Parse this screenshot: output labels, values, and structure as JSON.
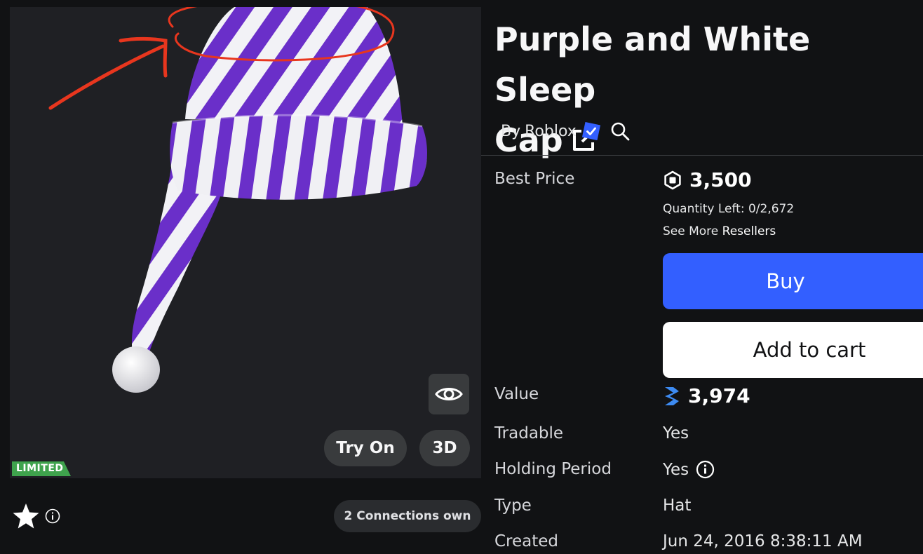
{
  "viewer": {
    "badge_limited": "LIMITED",
    "try_on_label": "Try On",
    "three_d_label": "3D",
    "eye_icon": "eye-icon"
  },
  "below_viewer": {
    "favorite_icon": "star-icon",
    "info_icon": "info-icon",
    "connections_label": "2 Connections own"
  },
  "item": {
    "title_line1": "Purple and White Sleep",
    "title_line2": "Cap",
    "creator_prefix": "By",
    "creator_name": "Roblox",
    "verified_icon": "verified-badge-icon",
    "search_icon": "search-icon"
  },
  "details": {
    "best_price_label": "Best Price",
    "best_price_value": "3,500",
    "quantity_left": "Quantity Left: 0/2,672",
    "see_more_prefix": "See More",
    "see_more_link": "Resellers",
    "buy_label": "Buy",
    "add_to_cart_label": "Add to cart",
    "value_label": "Value",
    "value_amount": "3,974",
    "tradable_label": "Tradable",
    "tradable_value": "Yes",
    "holding_label": "Holding Period",
    "holding_value": "Yes",
    "type_label": "Type",
    "type_value": "Hat",
    "created_label": "Created",
    "created_value": "Jun 24, 2016 8:38:11 AM"
  },
  "colors": {
    "background": "#111214",
    "viewer_bg": "#1f2024",
    "buy_button": "#335fff",
    "limited_badge": "#3fa34d",
    "annotation": "#e8361e",
    "stripe_purple": "#6a2fc9"
  }
}
